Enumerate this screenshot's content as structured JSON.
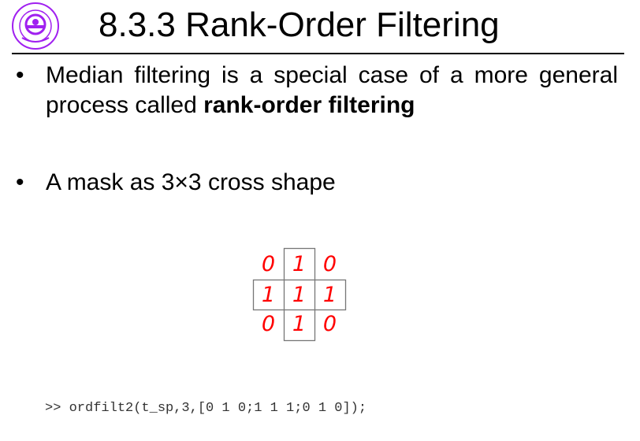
{
  "slide": {
    "title": "8.3.3 Rank-Order Filtering",
    "logo": {
      "text": "DALIAN UNIVERSITY OF TECHNOLOGY",
      "color": "#a020f0"
    },
    "bullets": [
      {
        "marker": "•",
        "text_before": "Median filtering is a special case of a more general process called ",
        "text_bold": "rank-order filtering"
      },
      {
        "marker": "•",
        "text": "A mask as 3×3 cross shape"
      }
    ],
    "mask": {
      "rows": [
        [
          "0",
          "1",
          "0"
        ],
        [
          "1",
          "1",
          "1"
        ],
        [
          "0",
          "1",
          "0"
        ]
      ],
      "color": "#ff0000"
    },
    "code": ">> ordfilt2(t_sp,3,[0 1 0;1 1 1;0 1 0]);"
  }
}
